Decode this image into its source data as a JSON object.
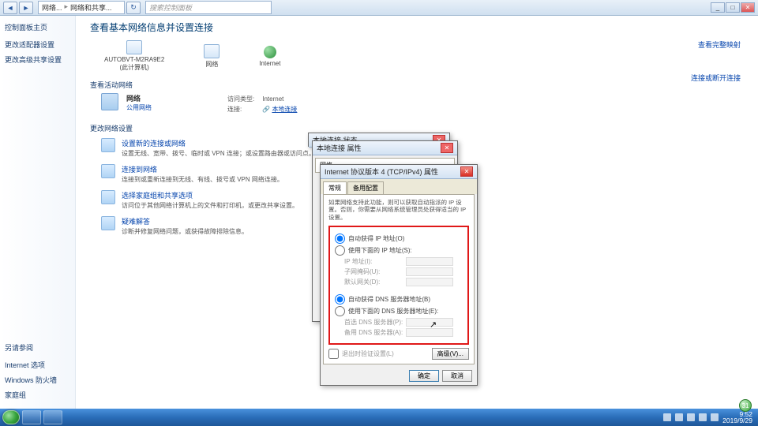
{
  "breadcrumb": {
    "c1": "网络...",
    "c2": "网络和共享...",
    "sep": "▸",
    "refresh": "↻"
  },
  "search": {
    "placeholder": "搜索控制面板"
  },
  "win": {
    "min": "_",
    "max": "□",
    "close": "✕"
  },
  "sidebar": {
    "home": "控制面板主页",
    "links": [
      "更改适配器设置",
      "更改高级共享设置"
    ],
    "also_h": "另请参阅",
    "also": [
      "Internet 选项",
      "Windows 防火墙",
      "家庭组"
    ]
  },
  "main": {
    "title": "查看基本网络信息并设置连接",
    "see_full_map": "查看完整映射",
    "map": {
      "node1": "AUTOBVT-M2RA9E2",
      "node1_sub": "(此计算机)",
      "node2": "网络",
      "node3": "Internet"
    },
    "active_h": "查看活动网络",
    "connect_link": "连接或断开连接",
    "net": {
      "name": "网络",
      "type": "公用网络",
      "k1": "访问类型:",
      "v1": "Internet",
      "k2": "连接:",
      "v2": "本地连接",
      "v2_icon": "🔗"
    },
    "change_h": "更改网络设置",
    "items": [
      {
        "t": "设置新的连接或网络",
        "d": "设置无线、宽带、拨号、临时或 VPN 连接；或设置路由器或访问点。"
      },
      {
        "t": "连接到网络",
        "d": "连接到或重新连接到无线、有线、拨号或 VPN 网络连接。"
      },
      {
        "t": "选择家庭组和共享选项",
        "d": "访问位于其他网络计算机上的文件和打印机，或更改共享设置。"
      },
      {
        "t": "疑难解答",
        "d": "诊断并修复网络问题，或获得故障排除信息。"
      }
    ]
  },
  "dlg_back1": {
    "title": "本地连接 状态"
  },
  "dlg_back2": {
    "title": "本地连接 属性",
    "tab": "网络"
  },
  "tcp": {
    "title": "Internet 协议版本 4 (TCP/IPv4) 属性",
    "tab1": "常规",
    "tab2": "备用配置",
    "hint": "如果网络支持此功能，则可以获取自动指派的 IP 设置。否则，你需要从网络系统管理员处获得适当的 IP 设置。",
    "r1": "自动获得 IP 地址(O)",
    "r2": "使用下面的 IP 地址(S):",
    "f1": "IP 地址(I):",
    "f2": "子网掩码(U):",
    "f3": "默认网关(D):",
    "r3": "自动获得 DNS 服务器地址(B)",
    "r4": "使用下面的 DNS 服务器地址(E):",
    "f4": "首选 DNS 服务器(P):",
    "f5": "备用 DNS 服务器(A):",
    "chk": "退出时验证设置(L)",
    "adv": "高级(V)...",
    "ok": "确定",
    "cancel": "取消"
  },
  "taskbar": {
    "time": "9:52",
    "date": "2019/9/29",
    "badge": "31"
  }
}
